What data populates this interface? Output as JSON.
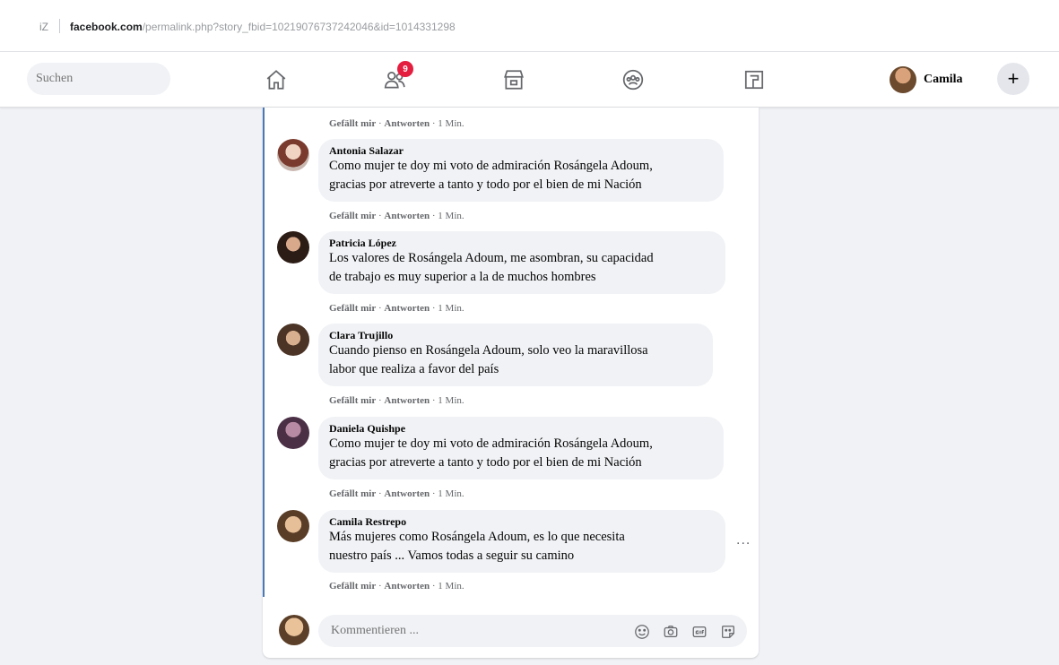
{
  "browser": {
    "url_prefix": "iZ",
    "url_host": "facebook.com",
    "url_path": "/permalink.php?story_fbid=10219076737242046&id=1014331298"
  },
  "nav": {
    "search_placeholder": "Suchen",
    "friends_badge": "9",
    "profile_name": "Camila",
    "plus_label": "+"
  },
  "top_actions": {
    "like": "Gefällt mir",
    "reply": "Antworten",
    "time": "1 Min."
  },
  "comments": [
    {
      "name": "Antonia Salazar",
      "text_line1": "Como mujer te doy mi voto de admiración Rosángela Adoum,",
      "text_line2": "gracias por atreverte a tanto y todo por el bien de mi Nación",
      "like": "Gefällt mir",
      "reply": "Antworten",
      "time": "1 Min."
    },
    {
      "name": "Patricia López",
      "text_line1": "Los valores de Rosángela Adoum, me asombran, su capacidad",
      "text_line2": "de trabajo es muy superior a la de muchos hombres",
      "like": "Gefällt mir",
      "reply": "Antworten",
      "time": "1 Min."
    },
    {
      "name": "Clara Trujillo",
      "text_line1": "Cuando pienso en Rosángela Adoum, solo veo la maravillosa",
      "text_line2": "labor que realiza a favor del país",
      "like": "Gefällt mir",
      "reply": "Antworten",
      "time": "1 Min."
    },
    {
      "name": "Daniela Quishpe",
      "text_line1": "Como mujer te doy mi voto de admiración Rosángela Adoum,",
      "text_line2": "gracias por atreverte a tanto y todo por el bien de mi Nación",
      "like": "Gefällt mir",
      "reply": "Antworten",
      "time": "1 Min."
    },
    {
      "name": "Camila Restrepo",
      "text_line1": "Más mujeres como Rosángela Adoum, es lo que necesita",
      "text_line2": "nuestro país ... Vamos todas a seguir su camino",
      "like": "Gefällt mir",
      "reply": "Antworten",
      "time": "1 Min.",
      "more": "..."
    }
  ],
  "composer": {
    "placeholder": "Kommentieren ..."
  },
  "colors": {
    "accent": "#1877f2",
    "thread_line": "#4a79b8",
    "badge": "#e41e3f"
  }
}
